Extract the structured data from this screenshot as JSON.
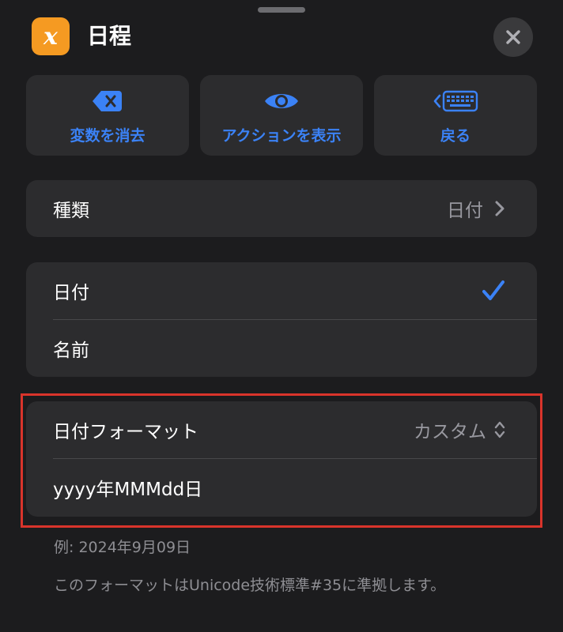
{
  "header": {
    "app_icon_glyph": "x",
    "title": "日程"
  },
  "toolbar": {
    "clear_variable": "変数を消去",
    "show_actions": "アクションを表示",
    "back": "戻る"
  },
  "type_row": {
    "label": "種類",
    "value": "日付"
  },
  "options": [
    {
      "label": "日付",
      "selected": true
    },
    {
      "label": "名前",
      "selected": false
    }
  ],
  "date_format": {
    "label": "日付フォーマット",
    "value": "カスタム",
    "format_string": "yyyy年MMMdd日"
  },
  "footnotes": {
    "example": "例: 2024年9月09日",
    "info": "このフォーマットはUnicode技術標準#35に準拠します。"
  },
  "colors": {
    "accent": "#3b82f6",
    "app_icon": "#f59a22",
    "highlight_border": "#d9342b"
  }
}
